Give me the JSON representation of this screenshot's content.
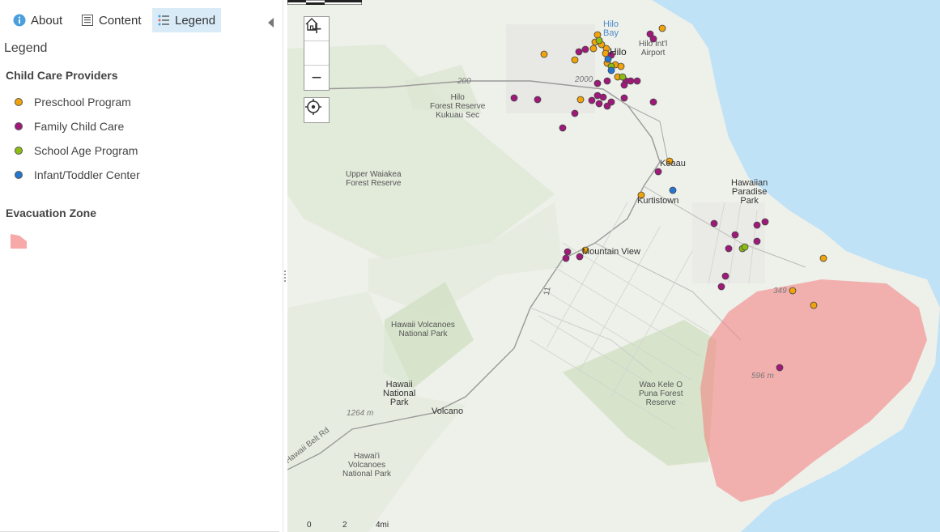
{
  "tabs": {
    "about": "About",
    "content": "Content",
    "legend": "Legend"
  },
  "panel": {
    "title": "Legend"
  },
  "legend": {
    "providers_title": "Child Care Providers",
    "items": [
      {
        "label": "Preschool Program",
        "color": "#f0a30a"
      },
      {
        "label": "Family Child Care",
        "color": "#a0197a"
      },
      {
        "label": "School Age Program",
        "color": "#8bbd12"
      },
      {
        "label": "Infant/Toddler Center",
        "color": "#2576d1"
      }
    ],
    "zone_title": "Evacuation Zone",
    "zone_color": "#f4a0a0"
  },
  "map": {
    "labels": {
      "hilo_bay": "Hilo\nBay",
      "hilo": "Hilo",
      "airport": "Hilo Int'l\nAirport",
      "elev_200": "200",
      "elev_2000": "2000",
      "hilo_forest": "Hilo\nForest Reserve\nKukuau Sec",
      "upper_waiakea": "Upper Waiakea\nForest Reserve",
      "keaau": "Keaau",
      "kurtistown": "Kurtistown",
      "hpp": "Hawaiian\nParadise\nPark",
      "mountain_view": "Mountain View",
      "elev_349": "349",
      "volcanoes_np": "Hawaii Volcanoes\nNational Park",
      "route_11": "11",
      "wao_kele": "Wao Kele O\nPuna Forest\nReserve",
      "elev_596": "596 m",
      "hnp": "Hawaii\nNational\nPark",
      "volcano": "Volcano",
      "elev_1264": "1264 m",
      "belt_rd": "Hawaii Belt Rd",
      "hawaii_vnp": "Hawai'i\nVolcanoes\nNational Park"
    },
    "scale": {
      "zero": "0",
      "two": "2",
      "four": "4mi"
    },
    "controls": {
      "zoom_in": "+",
      "zoom_out": "−"
    }
  }
}
